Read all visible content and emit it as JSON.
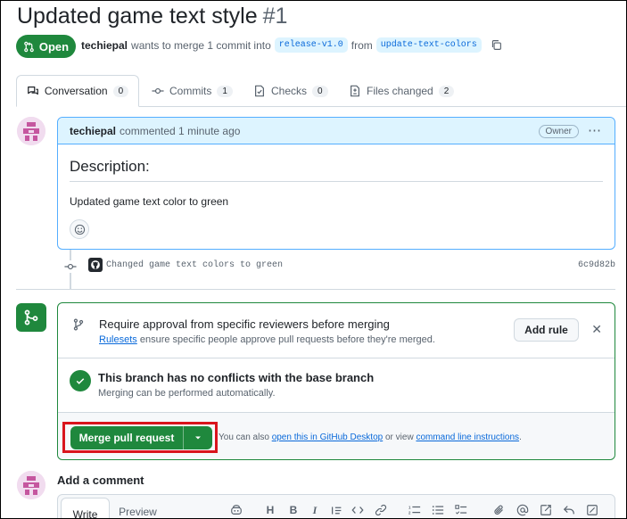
{
  "pr": {
    "title": "Updated game text style",
    "number": "#1",
    "state": "Open",
    "author": "techiepal",
    "merge_text": "wants to merge 1 commit into",
    "base_branch": "release-v1.0",
    "from_word": "from",
    "head_branch": "update-text-colors"
  },
  "tabs": [
    {
      "label": "Conversation",
      "count": "0",
      "icon": "comment-discussion-icon"
    },
    {
      "label": "Commits",
      "count": "1",
      "icon": "git-commit-icon"
    },
    {
      "label": "Checks",
      "count": "0",
      "icon": "checklist-icon"
    },
    {
      "label": "Files changed",
      "count": "2",
      "icon": "file-diff-icon"
    }
  ],
  "comment": {
    "author": "techiepal",
    "meta": "commented 1 minute ago",
    "badge": "Owner",
    "heading": "Description:",
    "body": "Updated game text color to green"
  },
  "commit": {
    "message": "Changed game text colors to green",
    "sha": "6c9d82b"
  },
  "merge_box": {
    "rule_title": "Require approval from specific reviewers before merging",
    "rule_link": "Rulesets",
    "rule_desc": "ensure specific people approve pull requests before they're merged.",
    "add_rule": "Add rule",
    "status_title": "This branch has no conflicts with the base branch",
    "status_sub": "Merging can be performed automatically.",
    "merge_button": "Merge pull request",
    "also_prefix": "You can also",
    "desktop_link": "open this in GitHub Desktop",
    "or_view": "or view",
    "cli_link": "command line instructions",
    "period": "."
  },
  "add_comment": {
    "title": "Add a comment",
    "write_tab": "Write",
    "preview_tab": "Preview",
    "toolbar": [
      "H",
      "B",
      "I"
    ]
  },
  "colors": {
    "accent_green": "#1f883d",
    "link_blue": "#0969da",
    "comment_header_bg": "#ddf4ff",
    "highlight_red": "#d9141c"
  }
}
